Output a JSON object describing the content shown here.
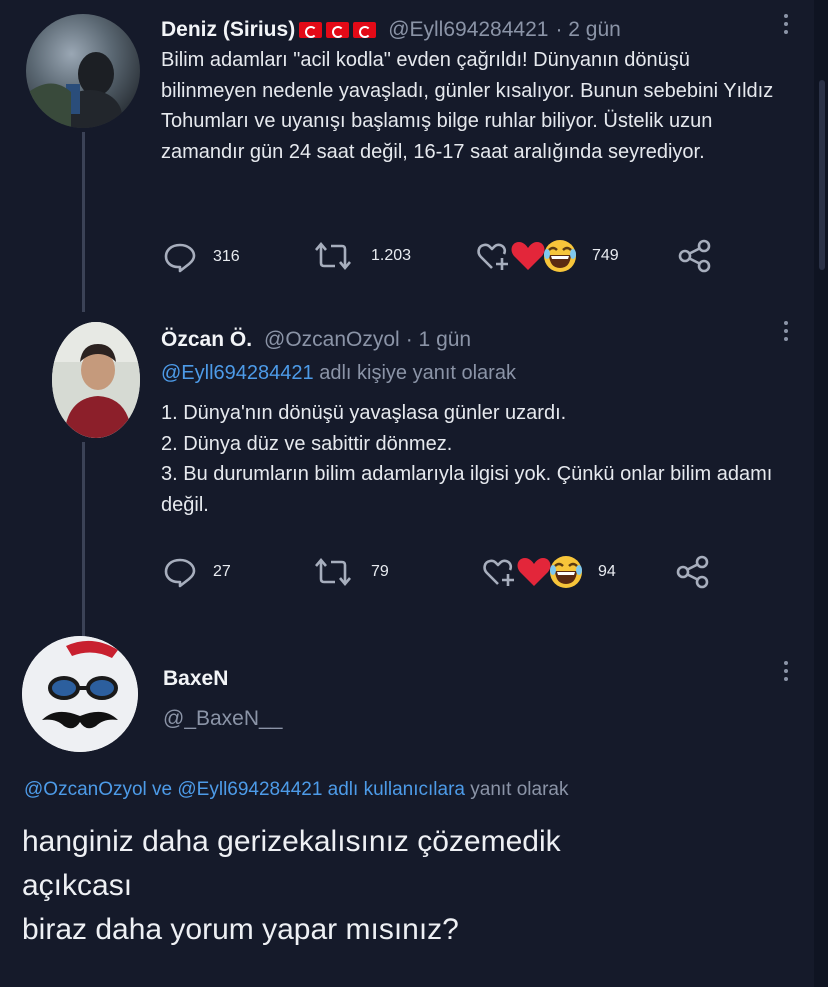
{
  "tweets": [
    {
      "name": "Deniz (Sirius)",
      "handle": "@Eyll694284421",
      "time": "· 2 gün",
      "body": "Bilim adamları \"acil kodla\" evden çağrıldı! Dünyanın dönüşü bilinmeyen nedenle yavaşladı, günler kısalıyor. Bunun sebebini Yıldız Tohumları ve uyanışı başlamış bilge ruhlar biliyor.  Üstelik uzun zamandır gün 24 saat değil, 16-17 saat aralığında seyrediyor.",
      "replies": "316",
      "retweets": "1.203",
      "reactions": "749"
    },
    {
      "name": "Özcan Ö.",
      "handle": "@OzcanOzyol",
      "time": "· 1 gün",
      "reply_mention": "@Eyll694284421",
      "reply_suffix": "adlı kişiye yanıt olarak",
      "body_lines": [
        "1. Dünya'nın dönüşü yavaşlasa günler uzardı.",
        "2. Dünya düz ve sabittir dönmez.",
        "3. Bu durumların bilim adamlarıyla ilgisi yok. Çünkü onlar bilim adamı değil."
      ],
      "replies": "27",
      "retweets": "79",
      "reactions": "94"
    }
  ],
  "main_reply": {
    "name": "BaxeN",
    "handle": "@_BaxeN__",
    "reply_mentions": "@OzcanOzyol ve @Eyll694284421 adlı kullanıcılara",
    "reply_suffix": "yanıt olarak",
    "text_lines": [
      "hanginiz daha gerizekalısınız çözemedik",
      "açıkcası",
      "biraz daha yorum yapar mısınız?"
    ]
  },
  "icons": {
    "reply": "speech-bubble-icon",
    "retweet": "retweet-icon",
    "add_reaction": "add-reaction-heart-icon",
    "heart": "red-heart-emoji",
    "laugh": "laughing-emoji",
    "share": "share-icon",
    "more": "vertical-dots-icon"
  },
  "colors": {
    "background": "#151a2a",
    "mention": "#4d9be8",
    "muted": "#8b94a7",
    "flag": "#e30a17"
  }
}
